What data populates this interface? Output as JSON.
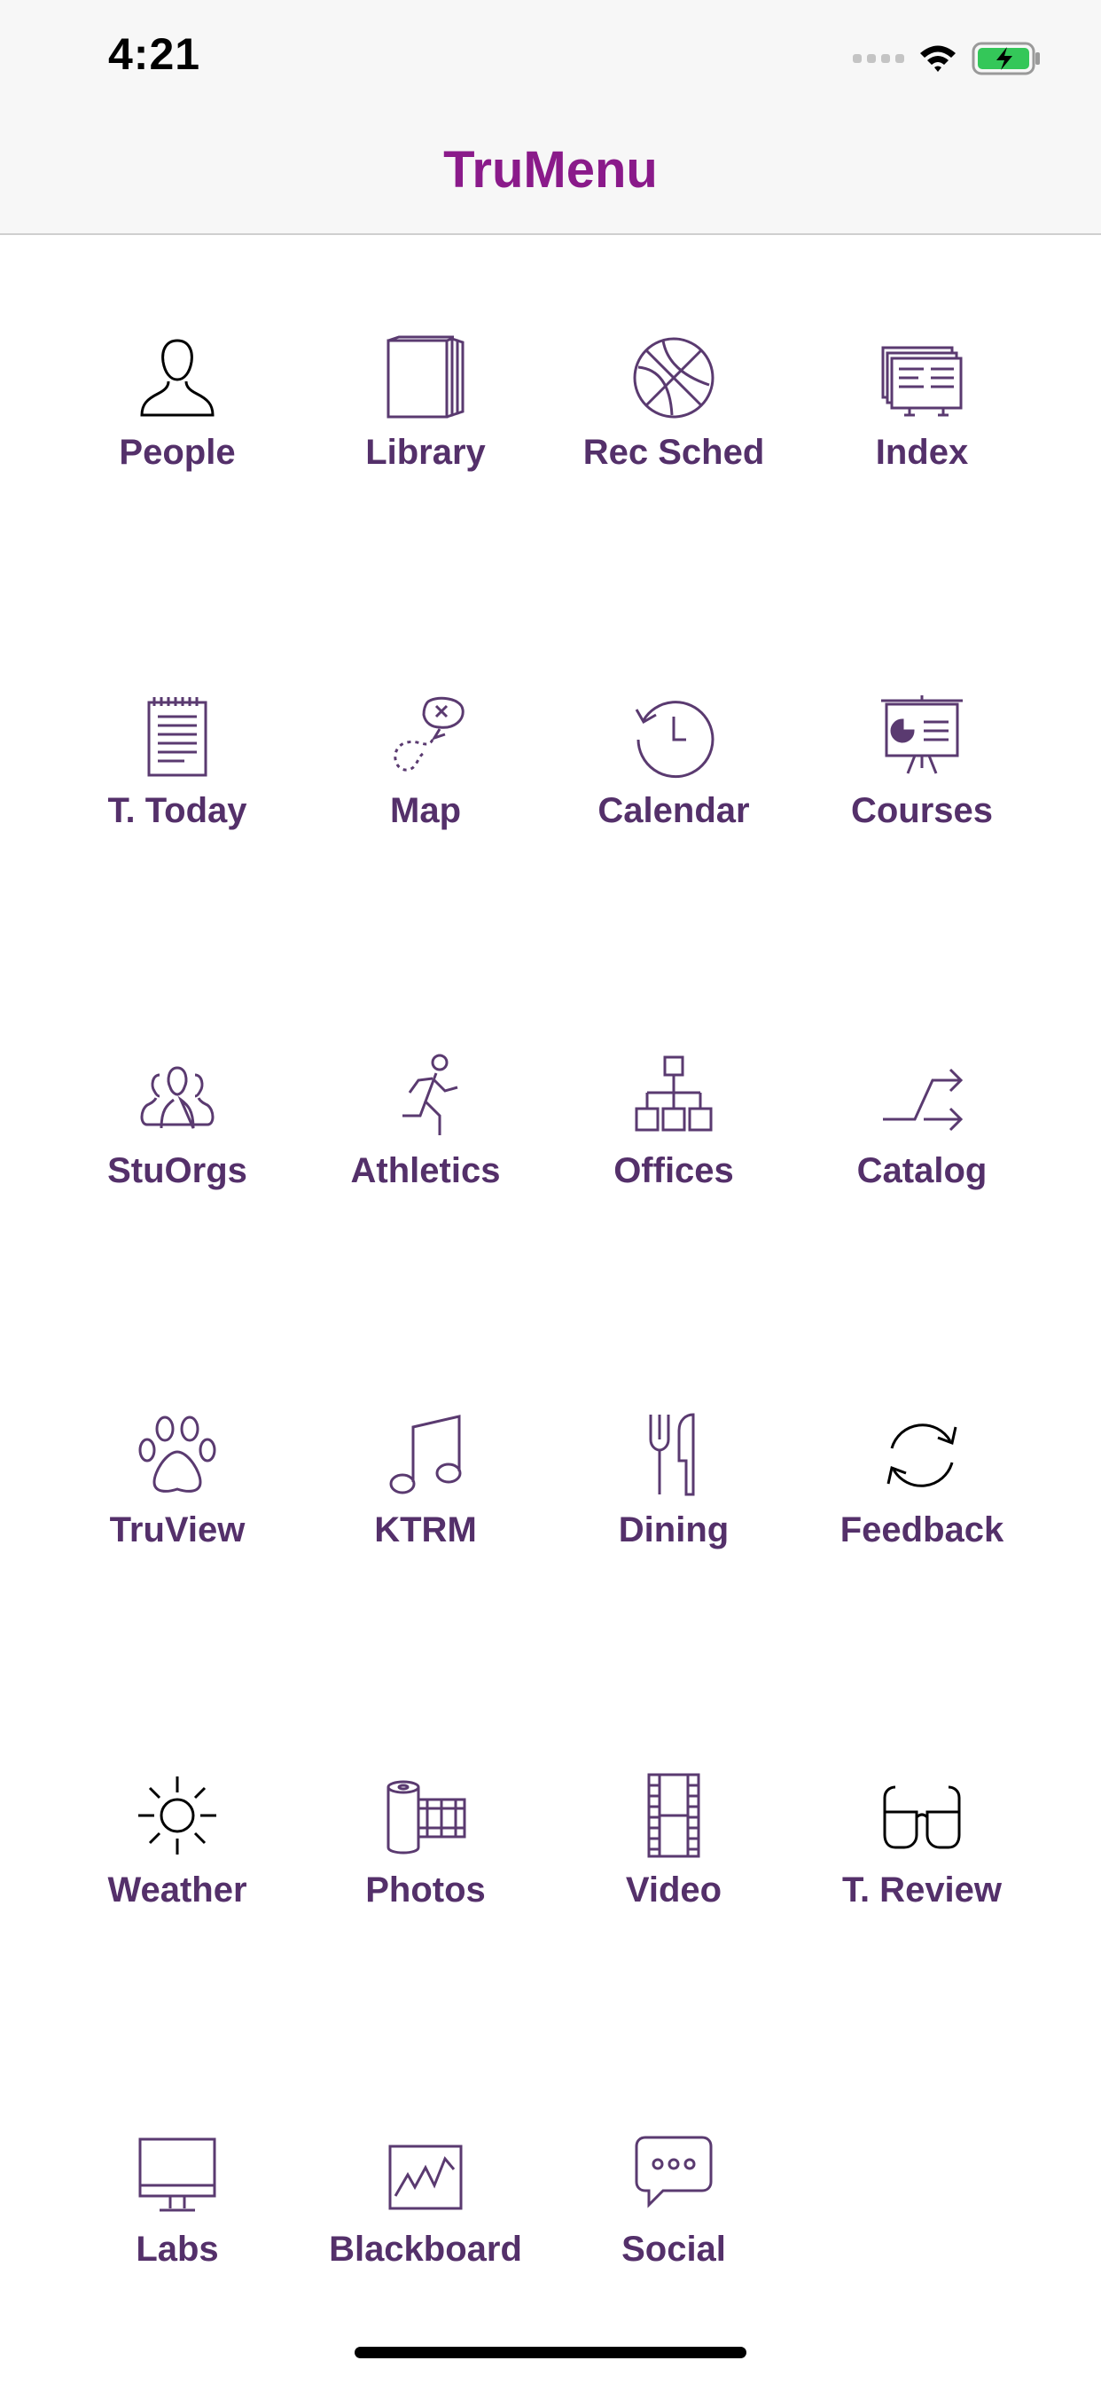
{
  "status_bar": {
    "time": "4:21"
  },
  "nav": {
    "title": "TruMenu"
  },
  "tiles": [
    {
      "label": "People",
      "icon": "person-icon"
    },
    {
      "label": "Library",
      "icon": "books-icon"
    },
    {
      "label": "Rec Sched",
      "icon": "basketball-icon"
    },
    {
      "label": "Index",
      "icon": "index-cards-icon"
    },
    {
      "label": "T. Today",
      "icon": "notepad-icon"
    },
    {
      "label": "Map",
      "icon": "map-route-icon"
    },
    {
      "label": "Calendar",
      "icon": "history-clock-icon"
    },
    {
      "label": "Courses",
      "icon": "presentation-board-icon"
    },
    {
      "label": "StuOrgs",
      "icon": "group-icon"
    },
    {
      "label": "Athletics",
      "icon": "runner-icon"
    },
    {
      "label": "Offices",
      "icon": "org-chart-icon"
    },
    {
      "label": "Catalog",
      "icon": "shuffle-arrow-icon"
    },
    {
      "label": "TruView",
      "icon": "paw-icon"
    },
    {
      "label": "KTRM",
      "icon": "music-note-icon"
    },
    {
      "label": "Dining",
      "icon": "fork-knife-icon"
    },
    {
      "label": "Feedback",
      "icon": "refresh-icon"
    },
    {
      "label": "Weather",
      "icon": "sun-icon"
    },
    {
      "label": "Photos",
      "icon": "film-roll-icon"
    },
    {
      "label": "Video",
      "icon": "film-strip-icon"
    },
    {
      "label": "T. Review",
      "icon": "glasses-icon"
    },
    {
      "label": "Labs",
      "icon": "monitor-icon"
    },
    {
      "label": "Blackboard",
      "icon": "chart-board-icon"
    },
    {
      "label": "Social",
      "icon": "chat-bubble-icon"
    }
  ],
  "colors": {
    "title": "#8a1a8a",
    "label": "#54306a",
    "icon": "#5a3a70"
  }
}
